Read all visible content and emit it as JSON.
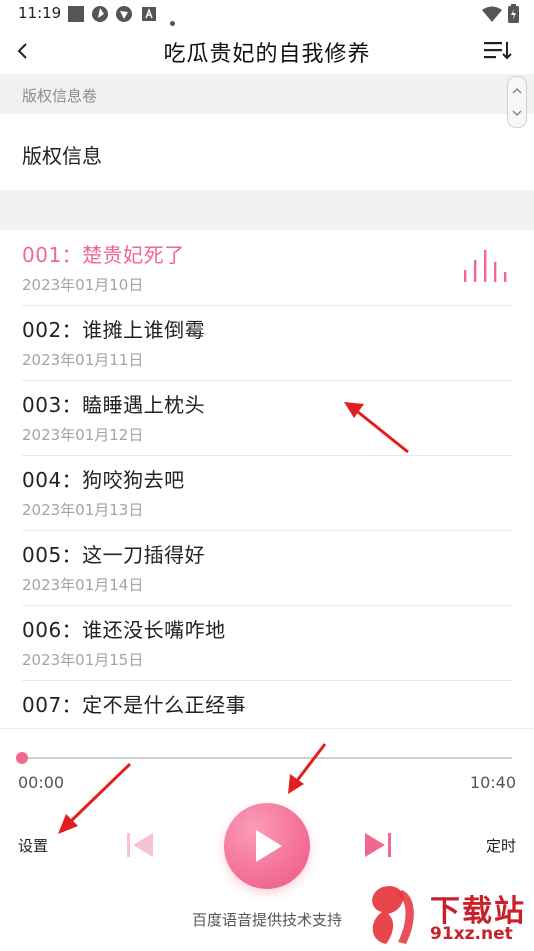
{
  "status_bar": {
    "time": "11:19"
  },
  "title_bar": {
    "title": "吃瓜贵妃的自我修养"
  },
  "toc": {
    "section_header": "版权信息卷",
    "copyright_item": "版权信息"
  },
  "chapters": [
    {
      "title": "001：楚贵妃死了",
      "date": "2023年01月10日",
      "active": true
    },
    {
      "title": "002：谁摊上谁倒霉",
      "date": "2023年01月11日"
    },
    {
      "title": "003：瞌睡遇上枕头",
      "date": "2023年01月12日"
    },
    {
      "title": "004：狗咬狗去吧",
      "date": "2023年01月13日"
    },
    {
      "title": "005：这一刀插得好",
      "date": "2023年01月14日"
    },
    {
      "title": "006：谁还没长嘴咋地",
      "date": "2023年01月15日"
    },
    {
      "title": "007：定不是什么正经事",
      "date": ""
    }
  ],
  "player": {
    "current_time": "00:00",
    "total_time": "10:40",
    "progress": 0,
    "settings_label": "设置",
    "timer_label": "定时",
    "credit": "百度语音提供技术支持"
  },
  "watermark": {
    "text": "下载站",
    "url": "91xz.net"
  },
  "colors": {
    "accent": "#f2678f",
    "annotation_arrow": "#e02020"
  }
}
